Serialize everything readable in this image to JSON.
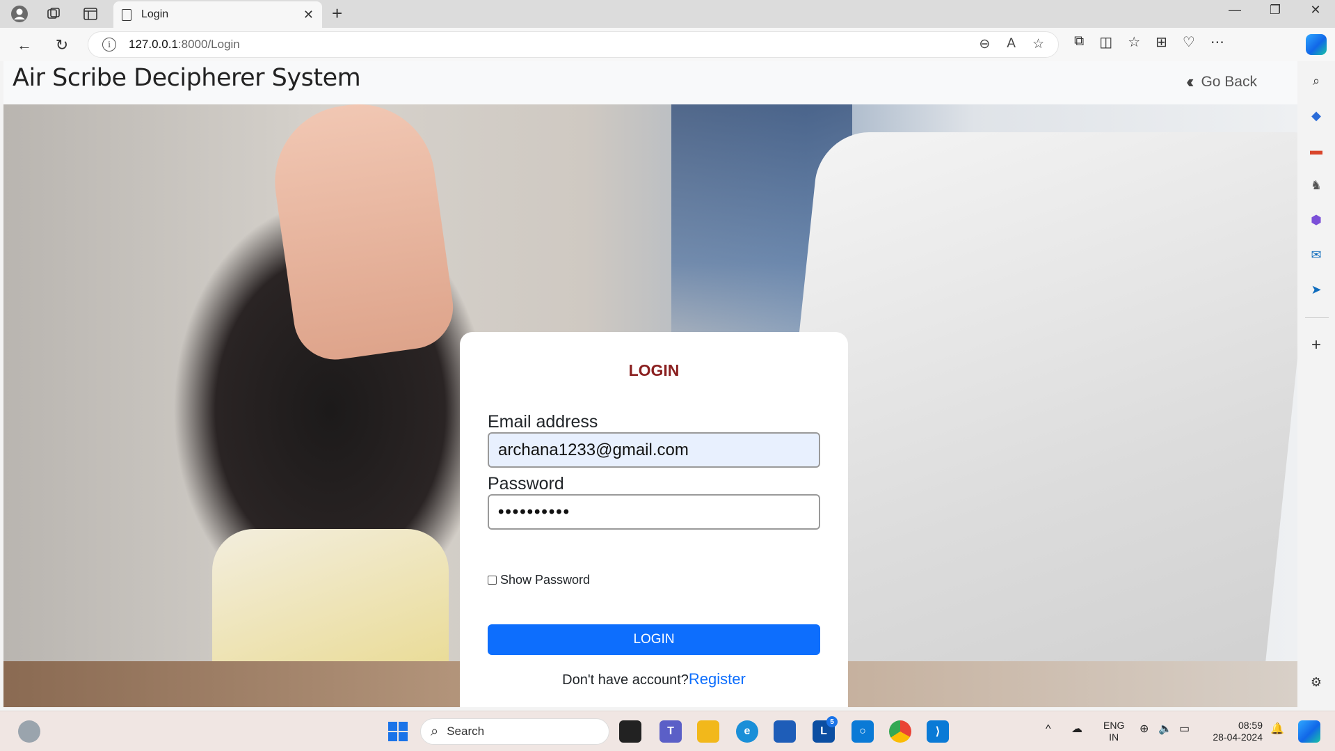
{
  "browser": {
    "tab_title": "Login",
    "url_host": "127.0.0.1",
    "url_path": ":8000/Login"
  },
  "page": {
    "brand": "Air Scribe Decipherer System",
    "go_back": "Go Back"
  },
  "login": {
    "title": "LOGIN",
    "email_label": "Email address",
    "email_value": "archana1233@gmail.com",
    "password_label": "Password",
    "password_masked": "••••••••••",
    "show_password_label": "Show Password",
    "button_label": "LOGIN",
    "no_account_text": "Don't have account?",
    "register_link": "Register"
  },
  "taskbar": {
    "search_label": "Search",
    "lang_top": "ENG",
    "lang_bottom": "IN",
    "time": "08:59",
    "date": "28-04-2024",
    "badge_count": "5"
  },
  "colors": {
    "accent_button": "#0d6efd",
    "title_color": "#8a1f1f",
    "link_color": "#0d6efd"
  }
}
